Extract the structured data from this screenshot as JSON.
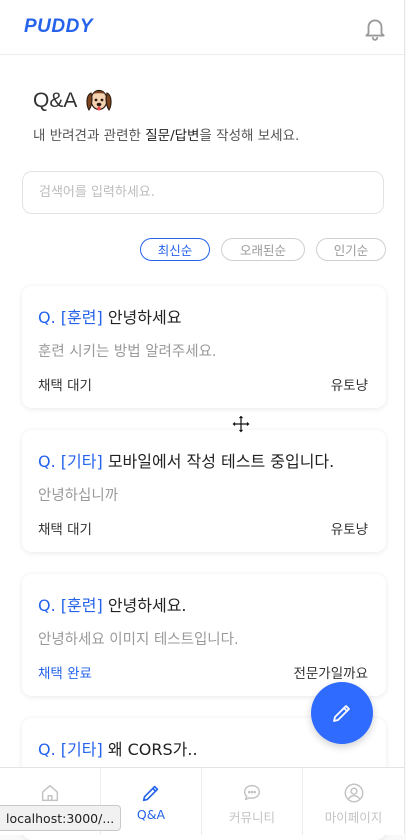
{
  "header": {
    "logo": "PUDDY"
  },
  "intro": {
    "title": "Q&A",
    "subtitle_pre": "내 반려견과 관련한 ",
    "subtitle_bold": "질문/답변",
    "subtitle_post": "을 작성해 보세요."
  },
  "search": {
    "placeholder": "검색어를 입력하세요."
  },
  "sort": [
    "최신순",
    "오래된순",
    "인기순"
  ],
  "posts": [
    {
      "prefix": "Q.",
      "tag": "[훈련]",
      "title": "안녕하세요",
      "body": "훈련 시키는 방법 알려주세요.",
      "status": "채택 대기",
      "author": "유토냥"
    },
    {
      "prefix": "Q.",
      "tag": "[기타]",
      "title": "모바일에서 작성 테스트 중입니다.",
      "body": "안녕하십니까",
      "status": "채택 대기",
      "author": "유토냥"
    },
    {
      "prefix": "Q.",
      "tag": "[훈련]",
      "title": "안녕하세요.",
      "body": "안녕하세요 이미지 테스트입니다.",
      "status": "채택 완료",
      "author": "전문가일까요"
    },
    {
      "prefix": "Q.",
      "tag": "[기타]",
      "title": "왜 CORS가..",
      "body": "",
      "status": "",
      "author": ""
    }
  ],
  "nav": [
    {
      "label": "",
      "icon": "home-icon"
    },
    {
      "label": "Q&A",
      "icon": "pencil-icon"
    },
    {
      "label": "커뮤니티",
      "icon": "chat-icon"
    },
    {
      "label": "마이페이지",
      "icon": "user-icon"
    }
  ],
  "status_url": "localhost:3000/...",
  "colors": {
    "accent": "#2563eb",
    "fab": "#2f6bff"
  }
}
